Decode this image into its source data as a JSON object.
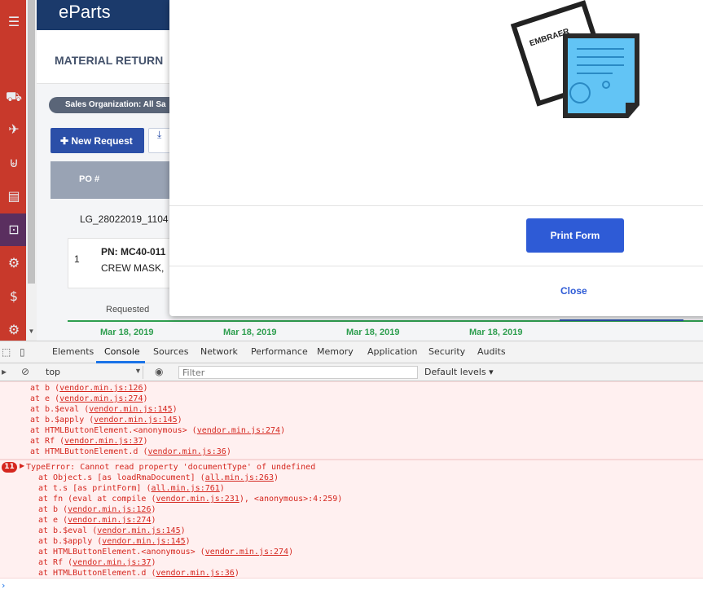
{
  "app": {
    "brand": "eParts",
    "page_title": "MATERIAL RETURN",
    "filter_chip": "Sales Organization: All Sa",
    "new_request_label": "New Request",
    "table_header_po": "PO #",
    "po_value": "LG_28022019_1104",
    "item_number": "1",
    "item_pn": "PN: MC40-011",
    "item_desc": "CREW MASK,",
    "timeline_label": "Requested",
    "timeline_dates": [
      "Mar 18, 2019",
      "Mar 18, 2019",
      "Mar 18, 2019",
      "Mar 18, 2019"
    ],
    "sidebar_icons": [
      "menu-icon",
      "truck-icon",
      "plane-icon",
      "cart-icon",
      "document-icon",
      "return-box-icon",
      "gears-icon",
      "money-icon",
      "settings-icon"
    ]
  },
  "modal": {
    "illustration_logo_text": "EMBRAER",
    "print_button_label": "Print Form",
    "close_label": "Close"
  },
  "devtools": {
    "tabs": [
      "Elements",
      "Console",
      "Sources",
      "Network",
      "Performance",
      "Memory",
      "Application",
      "Security",
      "Audits"
    ],
    "active_tab": "Console",
    "context": "top",
    "filter_placeholder": "Filter",
    "levels_label": "Default levels",
    "first_block": [
      {
        "text": "at b (",
        "link": "vendor.min.js:126",
        "tail": ")"
      },
      {
        "text": "at e (",
        "link": "vendor.min.js:274",
        "tail": ")"
      },
      {
        "text": "at b.$eval (",
        "link": "vendor.min.js:145",
        "tail": ")"
      },
      {
        "text": "at b.$apply (",
        "link": "vendor.min.js:145",
        "tail": ")"
      },
      {
        "text": "at HTMLButtonElement.<anonymous> (",
        "link": "vendor.min.js:274",
        "tail": ")"
      },
      {
        "text": "at Rf (",
        "link": "vendor.min.js:37",
        "tail": ")"
      },
      {
        "text": "at HTMLButtonElement.d (",
        "link": "vendor.min.js:36",
        "tail": ")"
      }
    ],
    "error_count": "11",
    "error_message": "TypeError: Cannot read property 'documentType' of undefined",
    "second_block": [
      {
        "text": "at Object.s [as loadRmaDocument] (",
        "link": "all.min.js:263",
        "tail": ")"
      },
      {
        "text": "at t.s [as printForm] (",
        "link": "all.min.js:761",
        "tail": ")"
      },
      {
        "text": "at fn (eval at compile (",
        "link": "vendor.min.js:231",
        "tail": "), <anonymous>:4:259)"
      },
      {
        "text": "at b (",
        "link": "vendor.min.js:126",
        "tail": ")"
      },
      {
        "text": "at e (",
        "link": "vendor.min.js:274",
        "tail": ")"
      },
      {
        "text": "at b.$eval (",
        "link": "vendor.min.js:145",
        "tail": ")"
      },
      {
        "text": "at b.$apply (",
        "link": "vendor.min.js:145",
        "tail": ")"
      },
      {
        "text": "at HTMLButtonElement.<anonymous> (",
        "link": "vendor.min.js:274",
        "tail": ")"
      },
      {
        "text": "at Rf (",
        "link": "vendor.min.js:37",
        "tail": ")"
      },
      {
        "text": "at HTMLButtonElement.d (",
        "link": "vendor.min.js:36",
        "tail": ")"
      }
    ]
  },
  "colors": {
    "sidebar": "#c8392b",
    "topbar": "#1b3a6b",
    "primary_button": "#2e5bd6",
    "error_text": "#d5271f",
    "error_bg": "#fff0f0",
    "timeline_green": "#2e9e4f"
  }
}
